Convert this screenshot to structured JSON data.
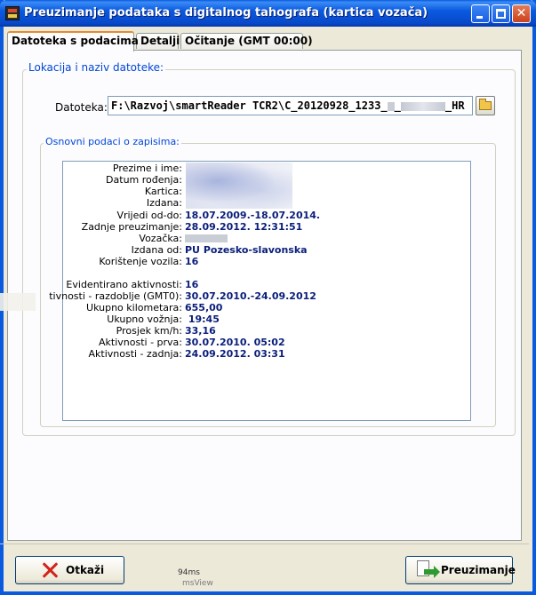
{
  "window": {
    "title": "Preuzimanje podataka s digitalnog tahografa (kartica vozača)",
    "buttons": [
      "minimize",
      "maximize",
      "close"
    ]
  },
  "tabs": [
    {
      "label": "Datoteka s podacima",
      "active": true
    },
    {
      "label": "Detalji",
      "active": false
    },
    {
      "label": "Očitanje (GMT 00:00)",
      "active": false
    }
  ],
  "file_group": {
    "legend": "Lokacija i naziv datoteke:",
    "label": "Datoteka:",
    "path_start": "F:\\Razvoj\\smartReader TCR2\\C_20120928_1233_",
    "path_end": "HR"
  },
  "info_group": {
    "legend": "Osnovni podaci o zapisima:",
    "rows": [
      {
        "label": "Prezime i ime:",
        "value": ""
      },
      {
        "label": "Datum rođenja:",
        "value": ""
      },
      {
        "label": "Kartica:",
        "value": ""
      },
      {
        "label": "Izdana:",
        "value": ""
      },
      {
        "label": "Vrijedi od-do:",
        "value": "18.07.2009.-18.07.2014."
      },
      {
        "label": "Zadnje preuzimanje:",
        "value": "28.09.2012. 12:31:51"
      },
      {
        "label": "Vozačka:",
        "value": ""
      },
      {
        "label": "Izdana od:",
        "value": "PU Pozesko-slavonska"
      },
      {
        "label": "Korištenje vozila:",
        "value": "16"
      },
      {
        "label": "Evidentirano aktivnosti:",
        "value": "16"
      },
      {
        "label": "tivnosti - razdoblje (GMT0):",
        "value": "30.07.2010.-24.09.2012"
      },
      {
        "label": "Ukupno kilometara:",
        "value": "655,00"
      },
      {
        "label": "Ukupno vožnja:",
        "value": " 19:45"
      },
      {
        "label": "Prosjek km/h:",
        "value": "33,16"
      },
      {
        "label": "Aktivnosti - prva:",
        "value": "30.07.2010. 05:02"
      },
      {
        "label": "Aktivnosti - zadnja:",
        "value": "24.09.2012. 03:31"
      }
    ]
  },
  "footer": {
    "cancel_label": "Otkaži",
    "import_label": "Preuzimanje",
    "timing": "94ms",
    "watermark": "msView"
  },
  "colors": {
    "titlebar": "#0a5ae0",
    "legend": "#0046d5",
    "value_text": "#0a1e7a",
    "active_tab_accent": "#e68b2c"
  }
}
